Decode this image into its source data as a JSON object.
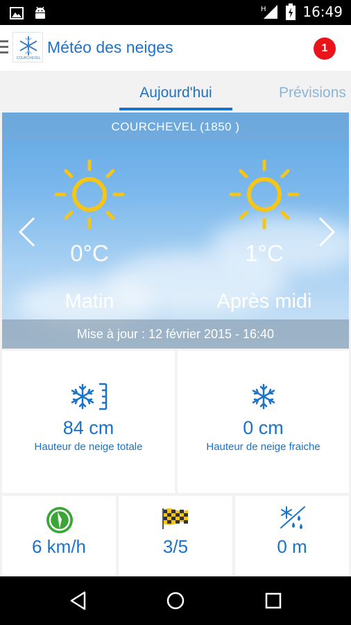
{
  "status_bar": {
    "time": "16:49",
    "icons": [
      "image-icon",
      "android-icon",
      "signal-icon",
      "battery-icon"
    ]
  },
  "app_bar": {
    "title": "Météo des neiges",
    "logo_text": "COURCHEVEL",
    "notification_count": "1"
  },
  "tabs": [
    {
      "label": "Aujourd'hui",
      "selected": true
    },
    {
      "label": "Prévisions",
      "selected": false
    }
  ],
  "weather": {
    "location": "COURCHEVEL (1850 )",
    "morning": {
      "temp": "0°C",
      "period": "Matin",
      "icon": "sun-icon"
    },
    "afternoon": {
      "temp": "1°C",
      "period": "Après midi",
      "icon": "sun-icon"
    },
    "updated": "Mise à jour :  12 février 2015 - 16:40"
  },
  "snow": {
    "total": {
      "value": "84 cm",
      "label": "Hauteur de neige totale",
      "icon": "snow-gauge-icon"
    },
    "fresh": {
      "value": "0 cm",
      "label": "Hauteur de neige fraiche",
      "icon": "snowflake-icon"
    }
  },
  "conditions": {
    "wind": {
      "value": "6 km/h",
      "icon": "wind-compass-icon"
    },
    "skiing": {
      "value": "3/5",
      "icon": "checkered-flag-icon"
    },
    "rain_snow_limit": {
      "value": "0 m",
      "icon": "snow-rain-icon"
    }
  },
  "colors": {
    "accent": "#1a73c9",
    "badge": "#e8141a",
    "sun": "#f5c518",
    "wind": "#3aa635"
  }
}
